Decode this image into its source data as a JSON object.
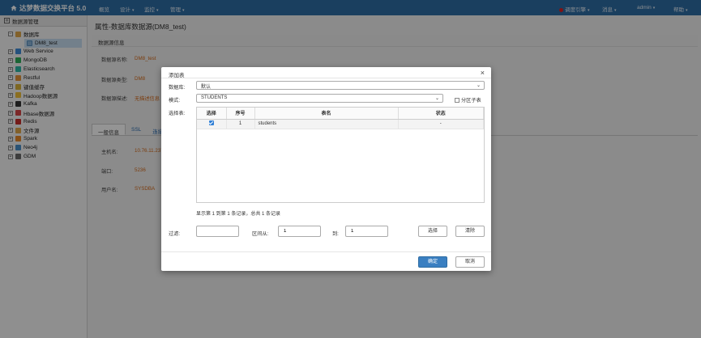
{
  "app": {
    "title": "达梦数据交换平台 5.0"
  },
  "nav": {
    "items": [
      {
        "label": "概览",
        "has_dropdown": false
      },
      {
        "label": "设计",
        "has_dropdown": true
      },
      {
        "label": "监控",
        "has_dropdown": true
      },
      {
        "label": "管理",
        "has_dropdown": true
      }
    ],
    "right": {
      "engine": "调度引擎",
      "messages": "消息",
      "user": "admin",
      "help": "帮助"
    }
  },
  "sidebar": {
    "title": "数据源管理",
    "items": [
      {
        "label": "数据库",
        "expanded": true,
        "color": "#e0a84a"
      },
      {
        "label": "DM8_test",
        "child": true,
        "selected": true
      },
      {
        "label": "Web Service",
        "color": "#3f8cd8"
      },
      {
        "label": "MongoDB",
        "color": "#2fae5a"
      },
      {
        "label": "Elasticsearch",
        "color": "#2eb8a6"
      },
      {
        "label": "Restful",
        "color": "#e6943a"
      },
      {
        "label": "键值缓存",
        "color": "#d8b13c"
      },
      {
        "label": "Hadoop数据源",
        "color": "#f0c03a"
      },
      {
        "label": "Kafka",
        "color": "#333333"
      },
      {
        "label": "Hbase数据源",
        "color": "#d64545"
      },
      {
        "label": "Redis",
        "color": "#c9302c"
      },
      {
        "label": "文件源",
        "color": "#e0a84a"
      },
      {
        "label": "Spark",
        "color": "#e88a2a"
      },
      {
        "label": "Neo4j",
        "color": "#4a90c9"
      },
      {
        "label": "GDM",
        "color": "#6a6a6a"
      }
    ]
  },
  "main": {
    "title": "属性-数据库数据源(DM8_test)",
    "panel_title": "数据源信息",
    "info": [
      {
        "label": "数据源名称:",
        "value": "DM8_test"
      },
      {
        "label": "数据源类型:",
        "value": "DM8"
      },
      {
        "label": "数据源描述:",
        "value": "无描述信息"
      }
    ],
    "tabs": [
      "一般信息",
      "SSL",
      "连接"
    ],
    "general": [
      {
        "label": "主机名:",
        "value": "10.76.11.237"
      },
      {
        "label": "端口:",
        "value": "5236"
      },
      {
        "label": "用户名:",
        "value": "SYSDBA"
      }
    ]
  },
  "dialog": {
    "title": "添加表",
    "database_label": "数据库:",
    "database_value": "默认",
    "schema_label": "模式:",
    "schema_value": "STUDENTS",
    "partition_label": "分区子表",
    "table_label": "选择表:",
    "columns": [
      "选择",
      "序号",
      "表名",
      "状态"
    ],
    "rows": [
      {
        "selected": true,
        "index": "1",
        "name": "students",
        "status": "-"
      }
    ],
    "summary": "显示第 1 到第 1 条记录，总共 1 条记录",
    "filter_label": "过滤:",
    "filter_value": "",
    "range_from_label": "区间从:",
    "range_from_value": "1",
    "range_to_label": "到:",
    "range_to_value": "1",
    "select_button": "选择",
    "clear_button": "清除",
    "confirm_button": "确定",
    "cancel_button": "取消"
  }
}
